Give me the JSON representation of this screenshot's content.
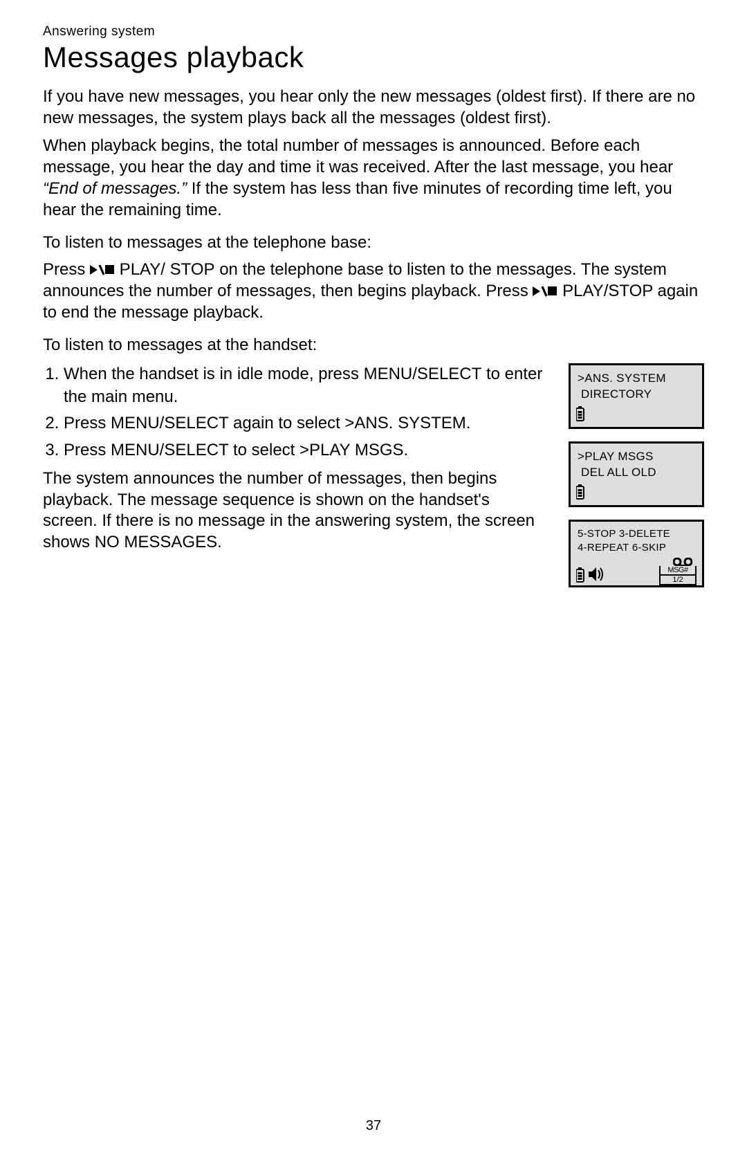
{
  "header": {
    "pretitle": "Answering system",
    "title": "Messages playback"
  },
  "intro": {
    "p1": "If you have new messages, you hear only the new messages (oldest first). If there are no new messages, the system plays back all the messages (oldest first).",
    "p2a": "When playback begins, the total number of messages is announced. Before each message, you hear the day and time it was received. After the last message, you hear ",
    "p2_em": "“End of messages.”",
    "p2b": " If the system has less than five minutes of recording time left, you hear the remaining time."
  },
  "base": {
    "heading": "To listen to messages at the telephone base:",
    "p_a": "Press ",
    "p_b": " PLAY/",
    "p_c": " STOP",
    "p_d": " on the telephone base to listen to the messages. The system announces the number of messages, then begins playback. Press ",
    "p_e": " PLAY",
    "p_f": "/STOP again to end the message playback."
  },
  "handset": {
    "heading": "To listen to messages at the handset:",
    "step1a": "When the handset is in idle mode, press ",
    "step1_btn1": "MENU/",
    "step1_btn2": "SELECT",
    "step1b": " to enter the main menu.",
    "step2a": "Press ",
    "step2_btn": "MENU/",
    "step2_btn2": "SELECT",
    "step2b": " again to select ",
    "step2_sel": ">ANS. SYSTEM",
    "step2c": ".",
    "step3a": "Press ",
    "step3_btn": "MENU/",
    "step3_btn2": "SELECT",
    "step3b": " to select ",
    "step3_sel": ">PLAY MSGS",
    "step3c": ".",
    "after_a": "The system announces the number of messages, then begins playback. The message sequence is shown on the handset's screen. If there is no message in the answering system, the screen shows ",
    "after_b": "NO MESSAGES",
    "after_c": "."
  },
  "screens": {
    "s1": {
      "l1": ">ANS. SYSTEM",
      "l2": " DIRECTORY"
    },
    "s2": {
      "l1": ">PLAY MSGS",
      "l2": " DEL ALL OLD"
    },
    "s3": {
      "l1": "5-STOP  3-DELETE",
      "l2": "4-REPEAT 6-SKIP",
      "msglabel": "MSG#",
      "msgnum": "1/2"
    }
  },
  "pagenum": "37"
}
